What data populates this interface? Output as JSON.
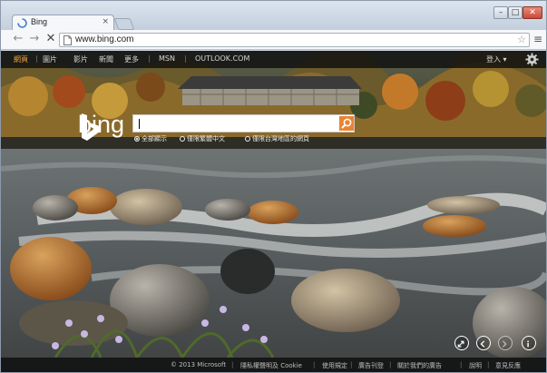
{
  "browser": {
    "tab_title": "Bing",
    "tab_close": "×",
    "url": "www.bing.com",
    "back_glyph": "←",
    "forward_glyph": "→",
    "reload_glyph": "✕",
    "star_glyph": "☆",
    "menu_glyph": "≡",
    "window_min": "–",
    "window_max": "□",
    "window_close": "✕"
  },
  "bing": {
    "nav": [
      {
        "label": "網頁",
        "active": true
      },
      {
        "label": "圖片",
        "active": false
      },
      {
        "label": "影片",
        "active": false
      },
      {
        "label": "新聞",
        "active": false
      },
      {
        "label": "更多",
        "active": false
      },
      {
        "label": "MSN",
        "active": false
      },
      {
        "label": "OUTLOOK.COM",
        "active": false
      }
    ],
    "signin": "登入 ▾",
    "logo_text": "bing",
    "search": {
      "value": "",
      "scopes": [
        {
          "label": "全部顯示",
          "selected": true
        },
        {
          "label": "僅限繁體中文",
          "selected": false
        },
        {
          "label": "僅限台灣地區的網頁",
          "selected": false
        }
      ]
    },
    "footer": [
      "© 2013 Microsoft",
      "隱私權聲明及 Cookie",
      "使用規定",
      "廣告刊登",
      "關於我們的廣告",
      "說明",
      "意見反應"
    ],
    "colors": {
      "accent": "#e98432",
      "nav_active": "#f2a43a",
      "bar": "#0f0f0f"
    }
  }
}
